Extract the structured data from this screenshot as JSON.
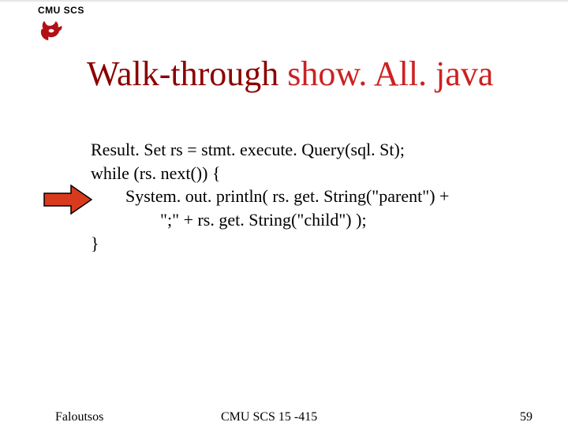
{
  "header": {
    "label": "CMU SCS"
  },
  "title": {
    "prefix": "Walk-through ",
    "filename": "show. All. java"
  },
  "code": {
    "line1": "Result. Set rs = stmt. execute. Query(sql. St);",
    "line2": "while (rs. next()) {",
    "line3": "        System. out. println( rs. get. String(\"parent\") +",
    "line4": "                \";\" + rs. get. String(\"child\") );",
    "line5": "}"
  },
  "footer": {
    "left": "Faloutsos",
    "mid": "CMU SCS 15 -415",
    "right": "59"
  },
  "icons": {
    "griffin": "griffin-logo",
    "arrow": "right-arrow"
  },
  "colors": {
    "title_dark": "#8b0000",
    "title_file": "#cc2222",
    "arrow_fill": "#d83a1e",
    "arrow_stroke": "#000000"
  }
}
